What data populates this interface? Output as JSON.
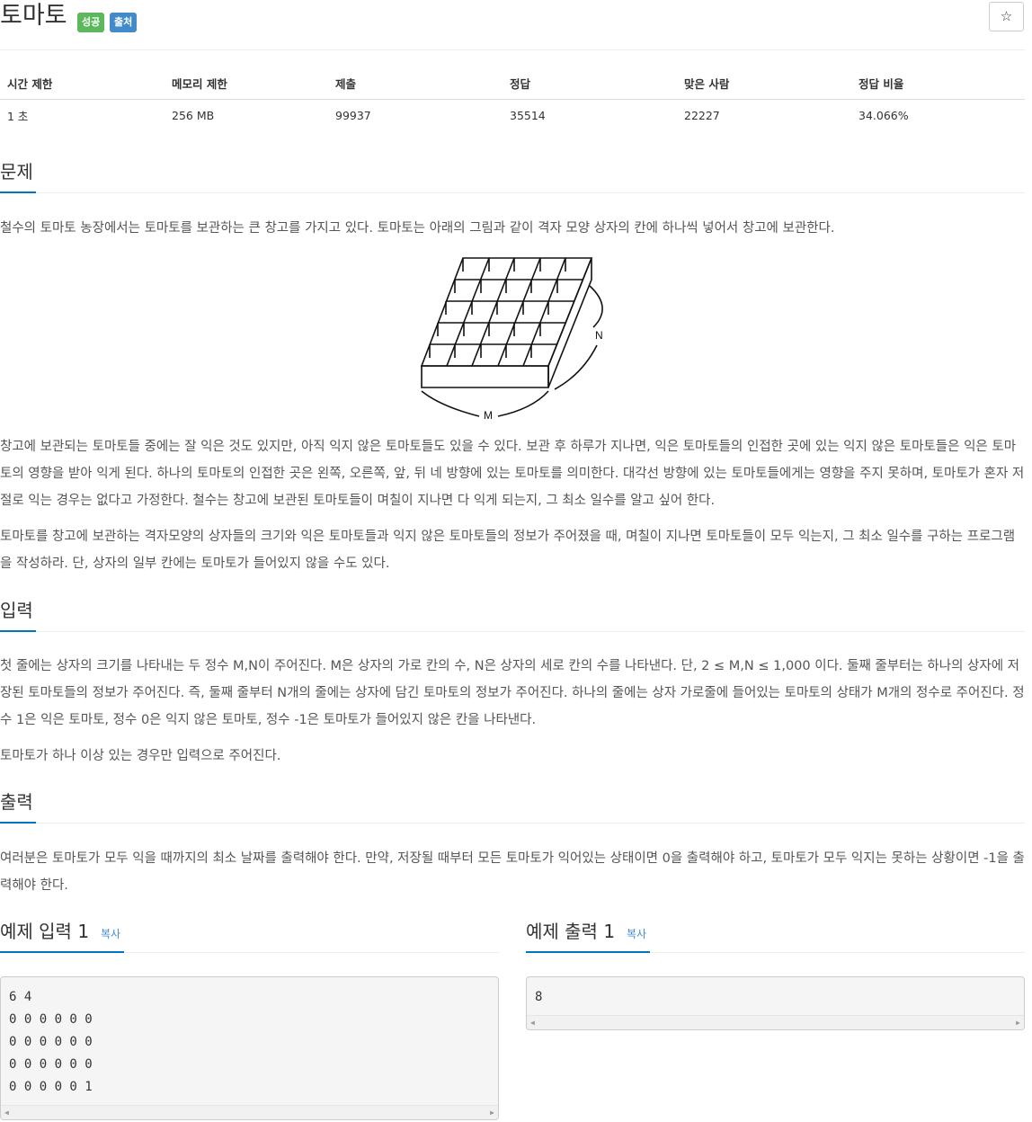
{
  "problem": {
    "title": "토마토",
    "badge_success": "성공",
    "badge_source": "출처",
    "star": "☆"
  },
  "info_table": {
    "headers": [
      "시간 제한",
      "메모리 제한",
      "제출",
      "정답",
      "맞은 사람",
      "정답 비율"
    ],
    "values": [
      "1 초",
      "256 MB",
      "99937",
      "35514",
      "22227",
      "34.066%"
    ]
  },
  "sections": {
    "problem": {
      "title": "문제",
      "p1": "철수의 토마토 농장에서는 토마토를 보관하는 큰 창고를 가지고 있다. 토마토는 아래의 그림과 같이 격자 모양 상자의 칸에 하나씩 넣어서 창고에 보관한다.",
      "figure_label_n": "N",
      "figure_label_m": "M",
      "p2": "창고에 보관되는 토마토들 중에는 잘 익은 것도 있지만, 아직 익지 않은 토마토들도 있을 수 있다. 보관 후 하루가 지나면, 익은 토마토들의 인접한 곳에 있는 익지 않은 토마토들은 익은 토마토의 영향을 받아 익게 된다. 하나의 토마토의 인접한 곳은 왼쪽, 오른쪽, 앞, 뒤 네 방향에 있는 토마토를 의미한다. 대각선 방향에 있는 토마토들에게는 영향을 주지 못하며, 토마토가 혼자 저절로 익는 경우는 없다고 가정한다. 철수는 창고에 보관된 토마토들이 며칠이 지나면 다 익게 되는지, 그 최소 일수를 알고 싶어 한다.",
      "p3": "토마토를 창고에 보관하는 격자모양의 상자들의 크기와 익은 토마토들과 익지 않은 토마토들의 정보가 주어졌을 때, 며칠이 지나면 토마토들이 모두 익는지, 그 최소 일수를 구하는 프로그램을 작성하라. 단, 상자의 일부 칸에는 토마토가 들어있지 않을 수도 있다."
    },
    "input": {
      "title": "입력",
      "p1": "첫 줄에는 상자의 크기를 나타내는 두 정수 M,N이 주어진다. M은 상자의 가로 칸의 수, N은 상자의 세로 칸의 수를 나타낸다. 단, 2 ≤ M,N ≤ 1,000 이다. 둘째 줄부터는 하나의 상자에 저장된 토마토들의 정보가 주어진다. 즉, 둘째 줄부터 N개의 줄에는 상자에 담긴 토마토의 정보가 주어진다. 하나의 줄에는 상자 가로줄에 들어있는 토마토의 상태가 M개의 정수로 주어진다. 정수 1은 익은 토마토, 정수 0은 익지 않은 토마토, 정수 -1은 토마토가 들어있지 않은 칸을 나타낸다.",
      "p2": "토마토가 하나 이상 있는 경우만 입력으로 주어진다."
    },
    "output": {
      "title": "출력",
      "p1": "여러분은 토마토가 모두 익을 때까지의 최소 날짜를 출력해야 한다. 만약, 저장될 때부터 모든 토마토가 익어있는 상태이면 0을 출력해야 하고, 토마토가 모두 익지는 못하는 상황이면 -1을 출력해야 한다."
    }
  },
  "examples": {
    "input_title": "예제 입력 1",
    "output_title": "예제 출력 1",
    "copy_label": "복사",
    "input_lines": [
      "6 4",
      "0 0 0 0 0 0",
      "0 0 0 0 0 0",
      "0 0 0 0 0 0",
      "0 0 0 0 0 1"
    ],
    "output_lines": [
      "8"
    ],
    "scroll_left": "◀",
    "scroll_right": "▶"
  },
  "colors": {
    "success": "#5cb85c",
    "info": "#428bca",
    "accent_underline": "#0076c0"
  }
}
